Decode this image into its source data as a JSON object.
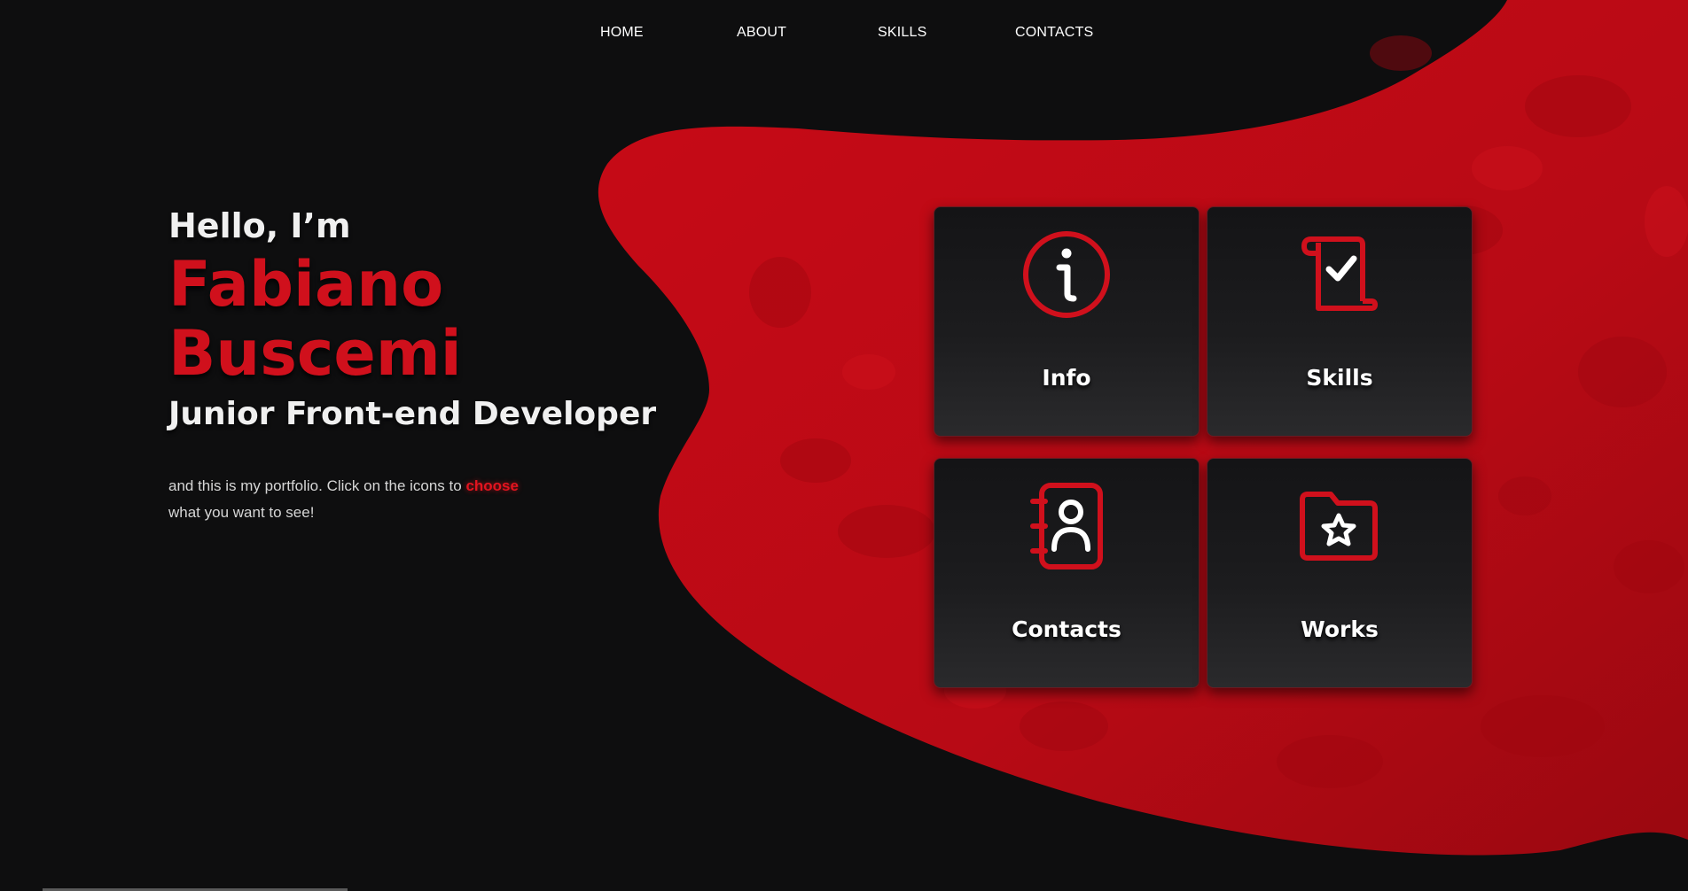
{
  "nav": {
    "items": [
      {
        "label": "HOME"
      },
      {
        "label": "ABOUT"
      },
      {
        "label": "SKILLS"
      },
      {
        "label": "CONTACTS"
      }
    ]
  },
  "hero": {
    "greeting": "Hello, I’m",
    "first_name": "Fabiano",
    "last_name": "Buscemi",
    "role": "Junior Front-end Developer",
    "intro_before": "and this is my portfolio. Click on the icons to ",
    "intro_highlight": "choose",
    "intro_after": "what you want to see!"
  },
  "cards": [
    {
      "label": "Info",
      "icon": "info-icon"
    },
    {
      "label": "Skills",
      "icon": "scroll-check-icon"
    },
    {
      "label": "Contacts",
      "icon": "contact-book-icon"
    },
    {
      "label": "Works",
      "icon": "folder-star-icon"
    }
  ],
  "colors": {
    "accent": "#d0101c",
    "background": "#0e0e0f",
    "card_top": "#141416",
    "card_bottom": "#2a2a2c",
    "text": "#f0f0f0"
  }
}
